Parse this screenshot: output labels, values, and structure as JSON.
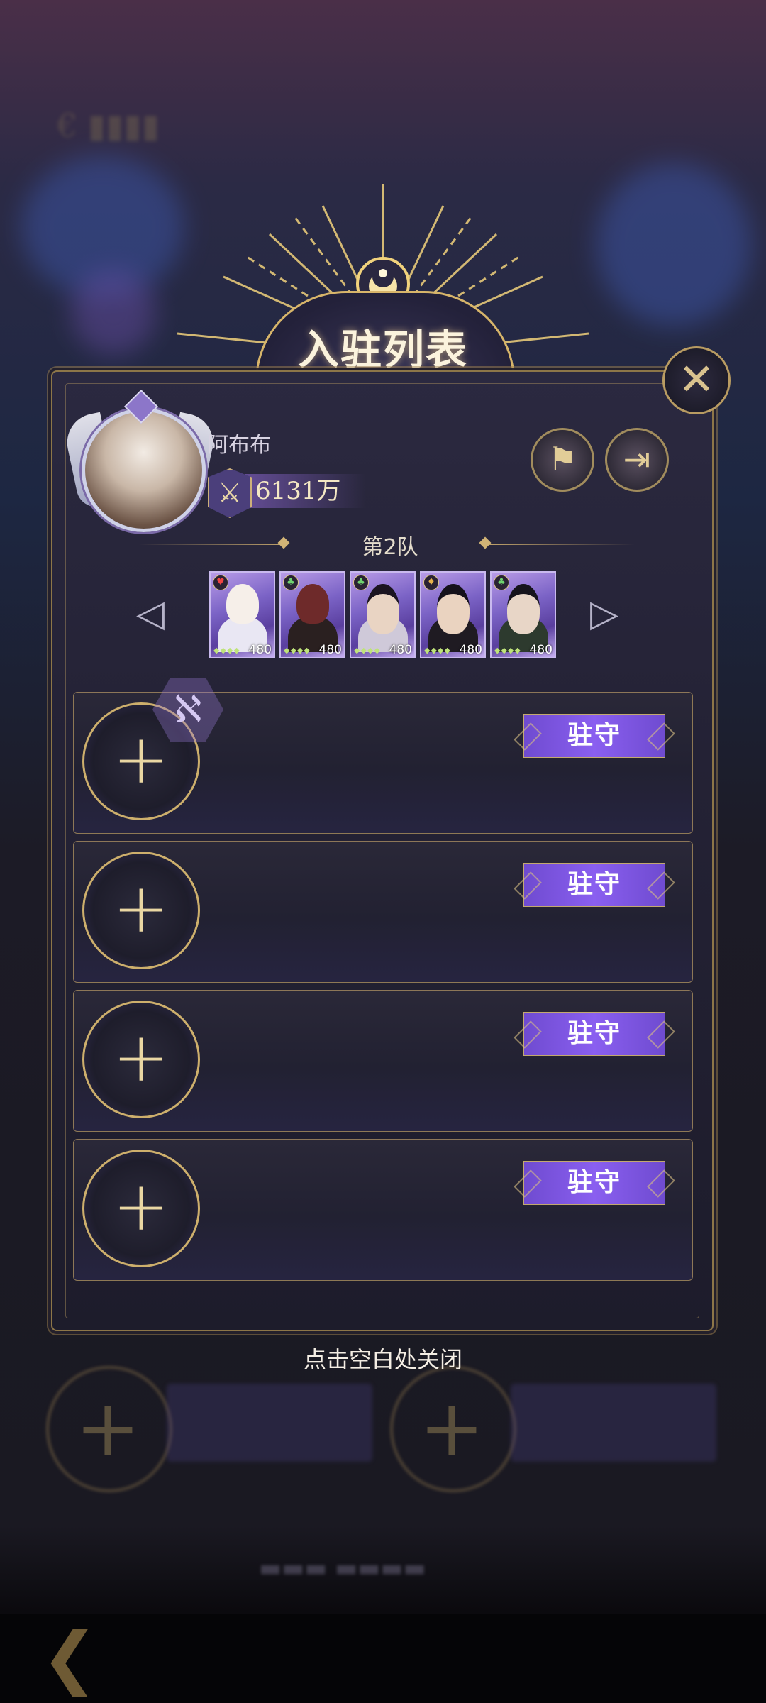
{
  "title": "入驻列表",
  "player": {
    "name": "阿布布",
    "power": "6131万"
  },
  "team": {
    "label": "第2队"
  },
  "heroes": [
    {
      "level": "480",
      "element": "heart"
    },
    {
      "level": "480",
      "element": "club"
    },
    {
      "level": "480",
      "element": "club"
    },
    {
      "level": "480",
      "element": "diamond"
    },
    {
      "level": "480",
      "element": "club"
    }
  ],
  "slots": [
    {
      "button": "驻守"
    },
    {
      "button": "驻守"
    },
    {
      "button": "驻守"
    },
    {
      "button": "驻守"
    }
  ],
  "hint": "点击空白处关闭",
  "icons": {
    "close": "close-icon",
    "flag": "flag-icon",
    "exit": "exit-icon",
    "add": "plus-icon",
    "prev": "left-arrow-icon",
    "next": "right-arrow-icon"
  },
  "colors": {
    "accent_gold": "#cdaf6c",
    "button_purple": "#8a5ff0"
  }
}
